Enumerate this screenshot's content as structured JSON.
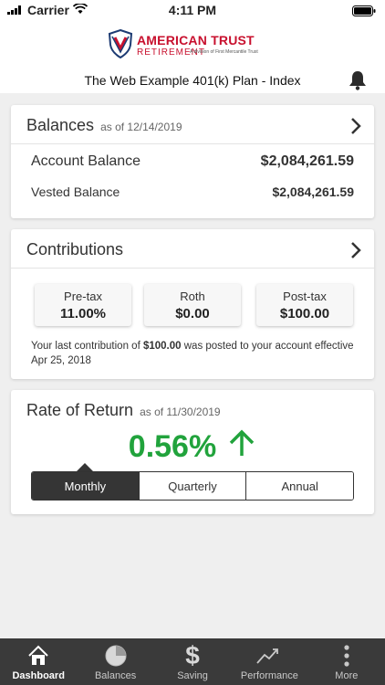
{
  "status": {
    "carrier": "Carrier",
    "time": "4:11 PM"
  },
  "brand": {
    "name": "AMERICAN TRUST",
    "sub": "RETIREMENT",
    "tag": "A division of First Mercantile Trust",
    "color": "#c8102e"
  },
  "header": {
    "plan_title": "The Web Example 401(k) Plan - Index"
  },
  "balances": {
    "title": "Balances",
    "as_of": "as of 12/14/2019",
    "account_label": "Account Balance",
    "account_value": "$2,084,261.59",
    "vested_label": "Vested Balance",
    "vested_value": "$2,084,261.59"
  },
  "contributions": {
    "title": "Contributions",
    "tiles": [
      {
        "label": "Pre-tax",
        "value": "11.00%"
      },
      {
        "label": "Roth",
        "value": "$0.00"
      },
      {
        "label": "Post-tax",
        "value": "$100.00"
      }
    ],
    "note_prefix": "Your last contribution of ",
    "note_amount": "$100.00",
    "note_suffix": " was posted to your account effective Apr 25, 2018"
  },
  "rate_of_return": {
    "title": "Rate of Return",
    "as_of": "as of 11/30/2019",
    "value": "0.56%",
    "positive_color": "#21a33c",
    "periods": [
      "Monthly",
      "Quarterly",
      "Annual"
    ],
    "selected": "Monthly"
  },
  "tabs": [
    {
      "label": "Dashboard",
      "icon": "home-icon",
      "active": true
    },
    {
      "label": "Balances",
      "icon": "pie-chart-icon",
      "active": false
    },
    {
      "label": "Saving",
      "icon": "dollar-icon",
      "active": false
    },
    {
      "label": "Performance",
      "icon": "trend-line-icon",
      "active": false
    },
    {
      "label": "More",
      "icon": "more-vertical-icon",
      "active": false
    }
  ]
}
